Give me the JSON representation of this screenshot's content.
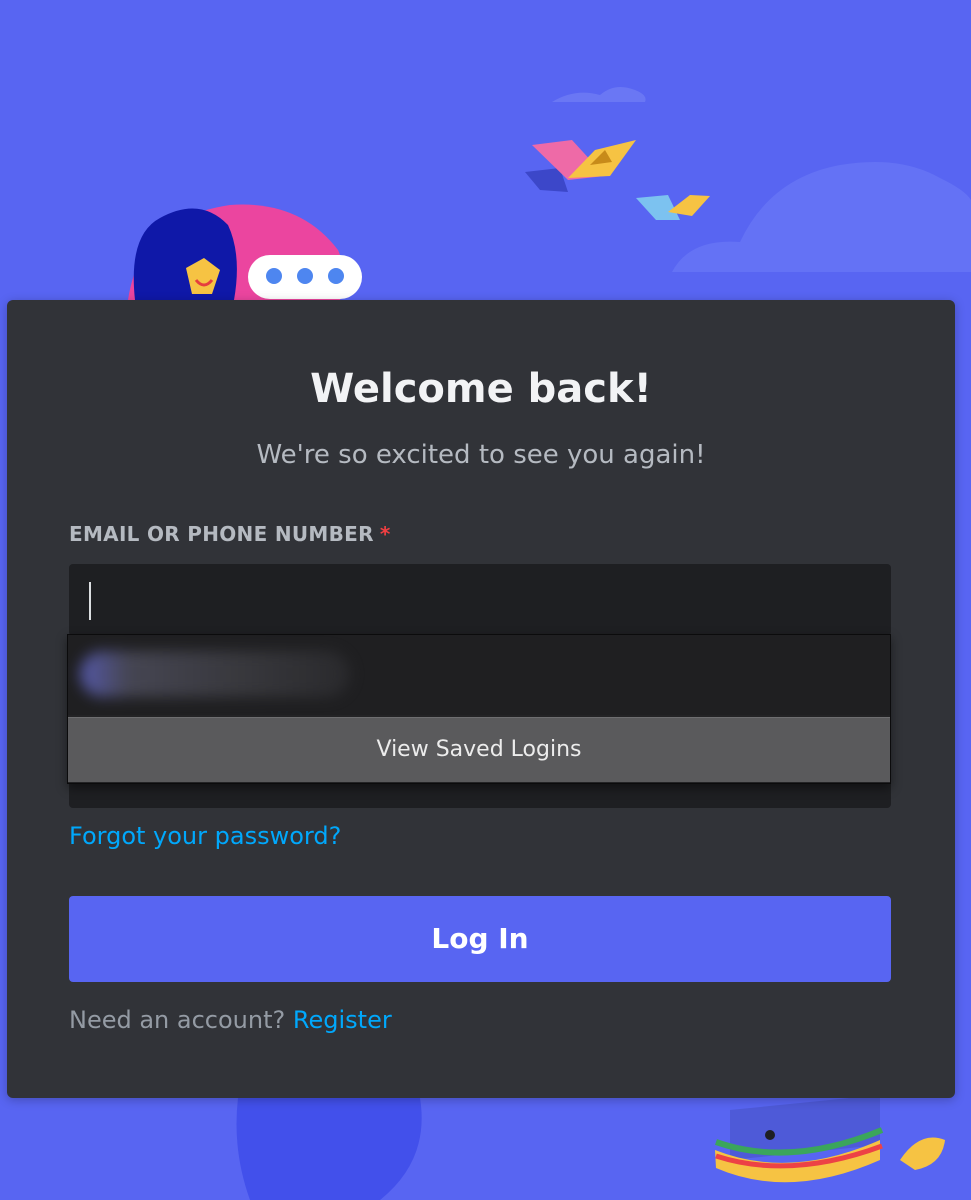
{
  "login": {
    "title": "Welcome back!",
    "subtitle": "We're so excited to see you again!",
    "email_label": "EMAIL OR PHONE NUMBER",
    "required_mark": "*",
    "email_value": "",
    "forgot_password": "Forgot your password?",
    "login_button": "Log In",
    "need_account": "Need an account?",
    "register": "Register"
  },
  "autofill": {
    "view_saved_logins": "View Saved Logins"
  },
  "colors": {
    "background": "#5865f2",
    "card": "#313338",
    "input": "#1e1f22",
    "link": "#00a8fc",
    "required": "#f23f42",
    "button": "#5865f2"
  },
  "icons": [
    "cloud-icon",
    "bird-icon",
    "character-illustration",
    "typing-bubble-icon",
    "sandwich-illustration"
  ]
}
